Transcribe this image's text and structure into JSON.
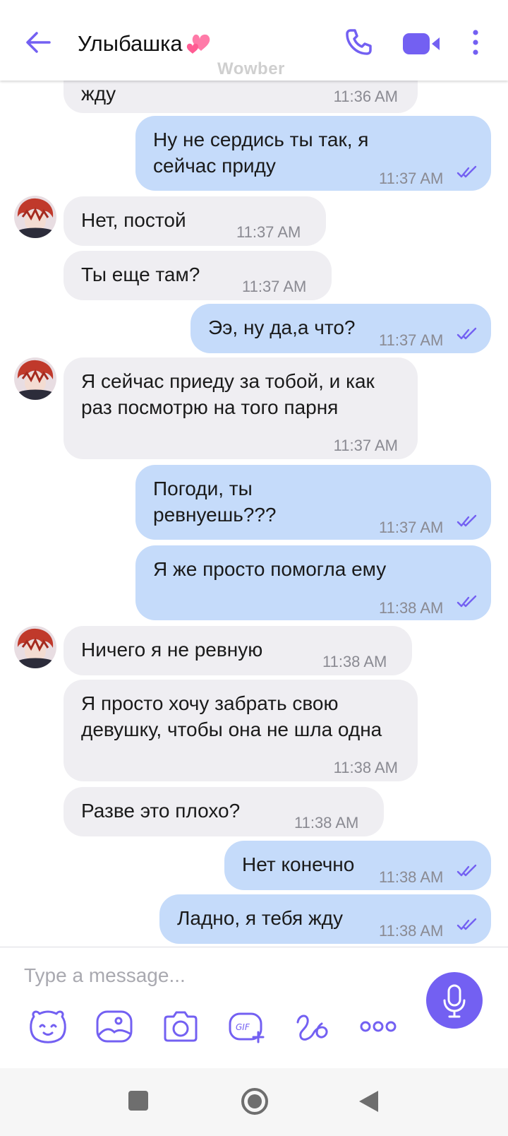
{
  "header": {
    "title": "Улыбашка",
    "title_emoji": "💞",
    "watermark": "Wowber"
  },
  "colors": {
    "accent": "#7360f2",
    "incoming_bubble": "#efeef2",
    "outgoing_bubble": "#c5dbfa"
  },
  "messages": [
    {
      "dir": "in",
      "text": "жду",
      "time": "11:36 AM"
    },
    {
      "dir": "out",
      "text": "Ну не сердись ты так, я сейчас приду",
      "time": "11:37 AM",
      "status": "read"
    },
    {
      "dir": "in",
      "text": "Нет, постой",
      "time": "11:37 AM",
      "avatar": true
    },
    {
      "dir": "in",
      "text": "Ты еще там?",
      "time": "11:37 AM"
    },
    {
      "dir": "out",
      "text": "Ээ, ну да,а что?",
      "time": "11:37 AM",
      "status": "read"
    },
    {
      "dir": "in",
      "text": "Я сейчас приеду за тобой, и как раз посмотрю на того парня",
      "time": "11:37 AM",
      "avatar": true
    },
    {
      "dir": "out",
      "text": "Погоди, ты ревнуешь???",
      "time": "11:37 AM",
      "status": "read"
    },
    {
      "dir": "out",
      "text": "Я же просто помогла ему",
      "time": "11:38 AM",
      "status": "read"
    },
    {
      "dir": "in",
      "text": "Ничего я не ревную",
      "time": "11:38 AM",
      "avatar": true
    },
    {
      "dir": "in",
      "text": "Я просто хочу забрать свою девушку, чтобы она не шла одна",
      "time": "11:38 AM"
    },
    {
      "dir": "in",
      "text": "Разве это плохо?",
      "time": "11:38 AM"
    },
    {
      "dir": "out",
      "text": "Нет конечно",
      "time": "11:38 AM",
      "status": "read"
    },
    {
      "dir": "out",
      "text": "Ладно, я тебя жду",
      "time": "11:38 AM",
      "status": "read"
    }
  ],
  "composer": {
    "placeholder": "Type a message...",
    "tools": [
      "sticker-icon",
      "gallery-icon",
      "camera-icon",
      "gif-icon",
      "doodle-icon",
      "more-icon"
    ],
    "mic": "microphone-icon"
  },
  "navbar": [
    "recents-button",
    "home-button",
    "back-button"
  ]
}
